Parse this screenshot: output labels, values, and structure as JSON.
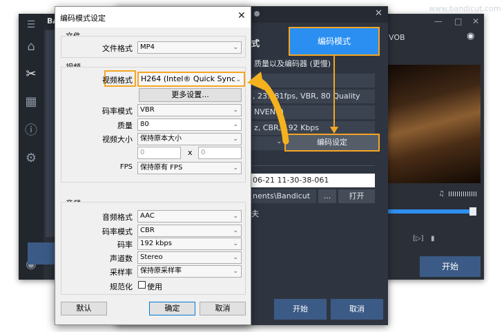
{
  "watermark": "www.bandicut.com",
  "app": {
    "title_fragment": "BA",
    "preview_label": "VOB",
    "start_label": "开始",
    "sidebar_icons": [
      "menu-icon",
      "home-icon",
      "cut-icon",
      "join-icon",
      "info-icon",
      "gear-icon",
      "record-icon"
    ]
  },
  "mid": {
    "encode_mode_button": "编码模式",
    "title_fragment": "式",
    "quality_label": "质量以及编码器 (更慢)",
    "video_info": ", 23.781fps, VBR, 80 Quality",
    "encoder_info": "NVENC)",
    "audio_info": "z, CBR, 192 Kbps",
    "encode_settings_button": "编码设定",
    "filename_value": "06-21 11-30-38-061",
    "path_value": "nents\\Bandicut",
    "browse_button": "...",
    "open_button": "打开",
    "truncated_label": "夫",
    "start_button": "开始",
    "cancel_button": "取消"
  },
  "dialog": {
    "title": "编码模式设定",
    "file_group": "文件",
    "file_format_label": "文件格式",
    "file_format_value": "MP4",
    "video_group": "视频",
    "video_format_label": "视频格式",
    "video_format_value": "H264 (Intel® Quick Sync",
    "more_settings_button": "更多设置...",
    "bitrate_mode_label": "码率模式",
    "bitrate_mode_value": "VBR",
    "quality_label": "质量",
    "quality_value": "80",
    "video_size_label": "视频大小",
    "video_size_value": "保持原本大小",
    "width_value": "0",
    "x_separator": "x",
    "height_value": "0",
    "fps_label": "FPS",
    "fps_value": "保持原有 FPS",
    "audio_group": "音频",
    "audio_format_label": "音频格式",
    "audio_format_value": "AAC",
    "audio_bitrate_mode_label": "码率模式",
    "audio_bitrate_mode_value": "CBR",
    "audio_bitrate_label": "码率",
    "audio_bitrate_value": "192 kbps",
    "channels_label": "声道数",
    "channels_value": "Stereo",
    "sample_rate_label": "采样率",
    "sample_rate_value": "保持原采样率",
    "normalize_label": "规范化",
    "normalize_checkbox_label": "使用",
    "normalize_checked": false,
    "default_button": "默认",
    "ok_button": "确定",
    "cancel_button": "取消"
  },
  "colors": {
    "highlight": "#f5a623",
    "accent_blue": "#2a8ff0",
    "app_bg": "#2b3038"
  }
}
